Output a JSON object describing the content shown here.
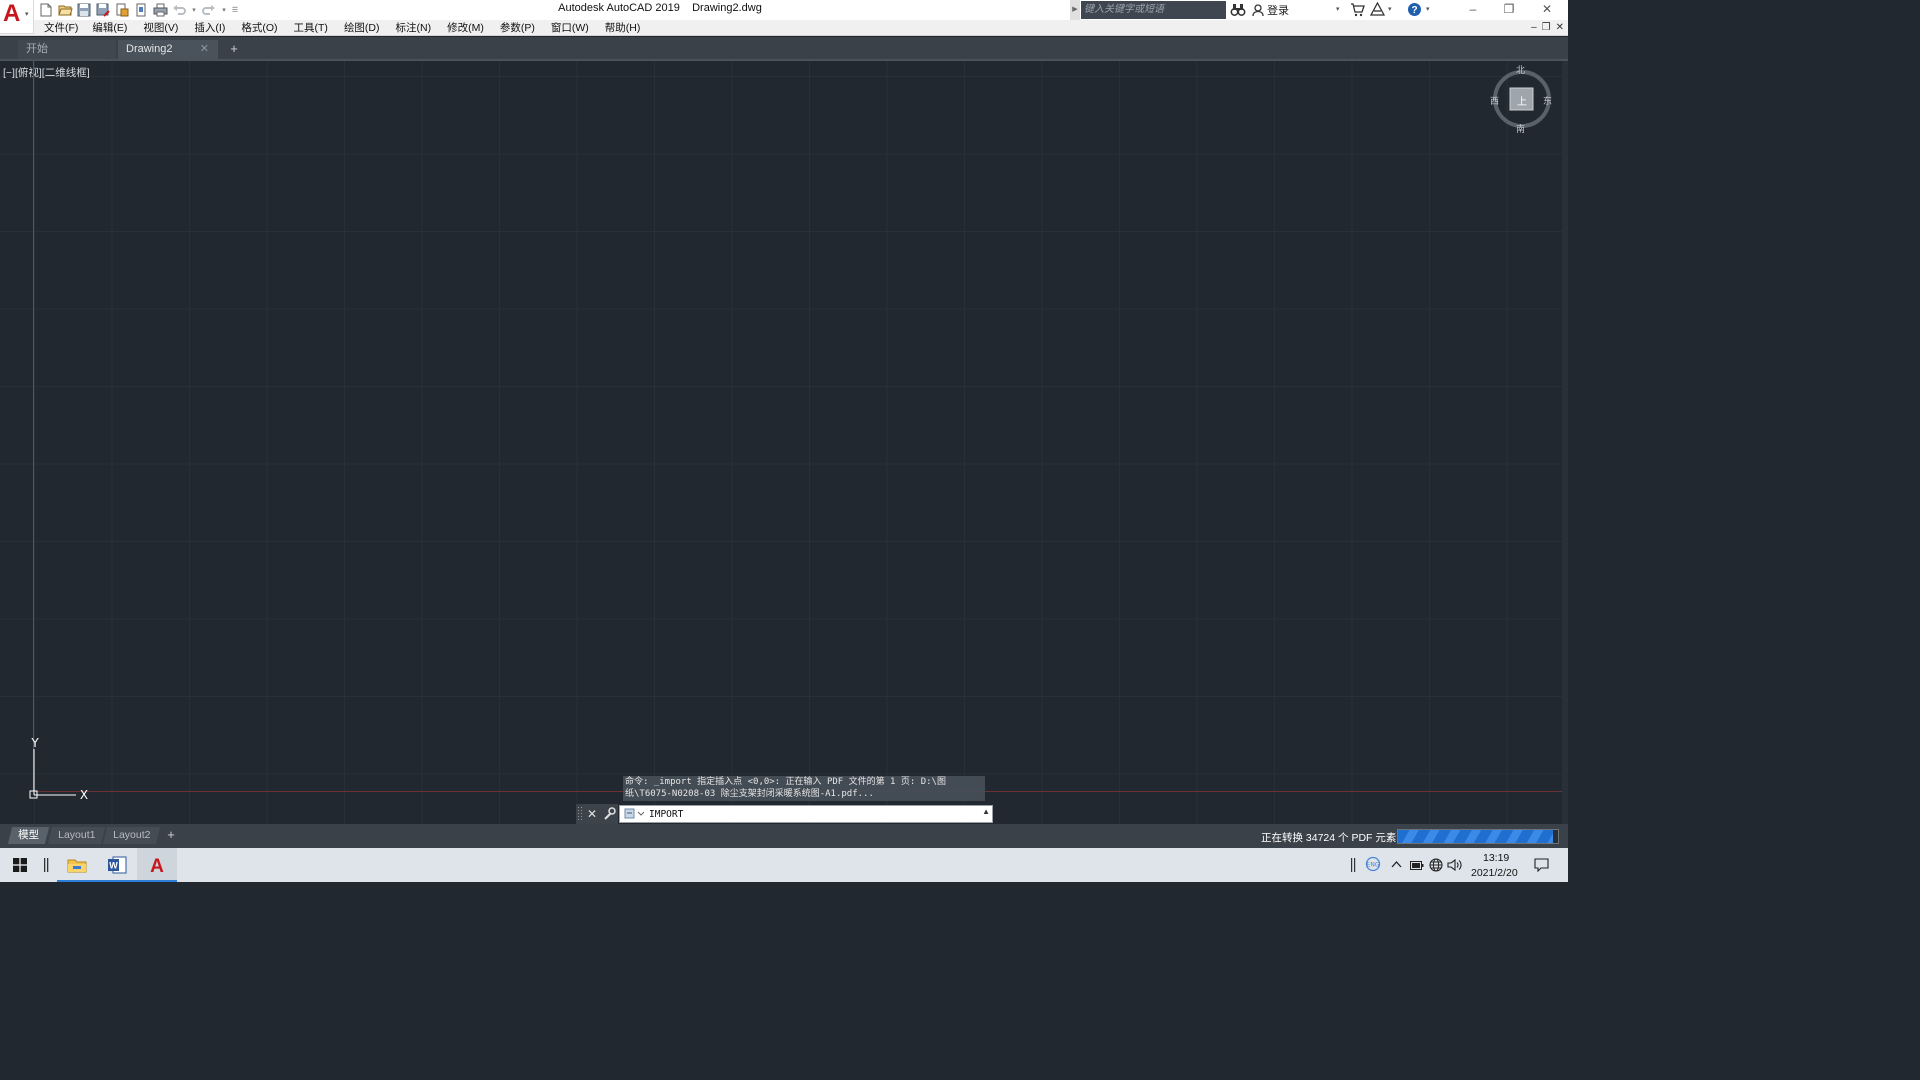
{
  "titlebar": {
    "app_name": "Autodesk AutoCAD 2019",
    "document_name": "Drawing2.dwg",
    "search_placeholder": "键入关键字或短语",
    "signin_label": "登录"
  },
  "menu": {
    "items": [
      "文件(F)",
      "编辑(E)",
      "视图(V)",
      "插入(I)",
      "格式(O)",
      "工具(T)",
      "绘图(D)",
      "标注(N)",
      "修改(M)",
      "参数(P)",
      "窗口(W)",
      "帮助(H)"
    ]
  },
  "file_tabs": {
    "start": "开始",
    "drawing": "Drawing2",
    "close_glyph": "✕",
    "add_glyph": "+"
  },
  "viewport": {
    "label": "[−][俯视][二维线框]",
    "ucs_x": "X",
    "ucs_y": "Y",
    "compass": {
      "north": "北",
      "south": "南",
      "east": "东",
      "west": "西",
      "face": "上"
    }
  },
  "command": {
    "history_line1": "命令: _import 指定插入点 <0,0>: 正在输入 PDF 文件的第 1 页: D:\\图",
    "history_line2": "纸\\T6075-N0208-03 除尘支架封闭采暖系统图-A1.pdf...",
    "input_value": "IMPORT",
    "close_glyph": "✕"
  },
  "layout_tabs": {
    "model": "模型",
    "layout1": "Layout1",
    "layout2": "Layout2",
    "add_glyph": "+"
  },
  "status": {
    "progress_text": "正在转换 34724 个 PDF 元素...",
    "progress_fraction": 0.97
  },
  "taskbar": {
    "time": "13:19",
    "date": "2021/2/20"
  },
  "icons": {
    "app": "autocad-app-icon",
    "qat": [
      "new-icon",
      "open-icon",
      "save-icon",
      "save-as-icon",
      "publish-icon",
      "plot-preview-icon",
      "plot-icon",
      "undo-icon",
      "redo-icon"
    ],
    "tray": [
      "ime-icon",
      "chevron-up-icon",
      "battery-icon",
      "network-icon",
      "volume-icon",
      "notification-icon"
    ]
  },
  "colors": {
    "canvas": "#212830",
    "grid": "#283039",
    "y_axis": "#3b6a3b",
    "x_axis": "#6b3236",
    "progress": "#1f6fd1",
    "brand_red": "#c8161d"
  }
}
